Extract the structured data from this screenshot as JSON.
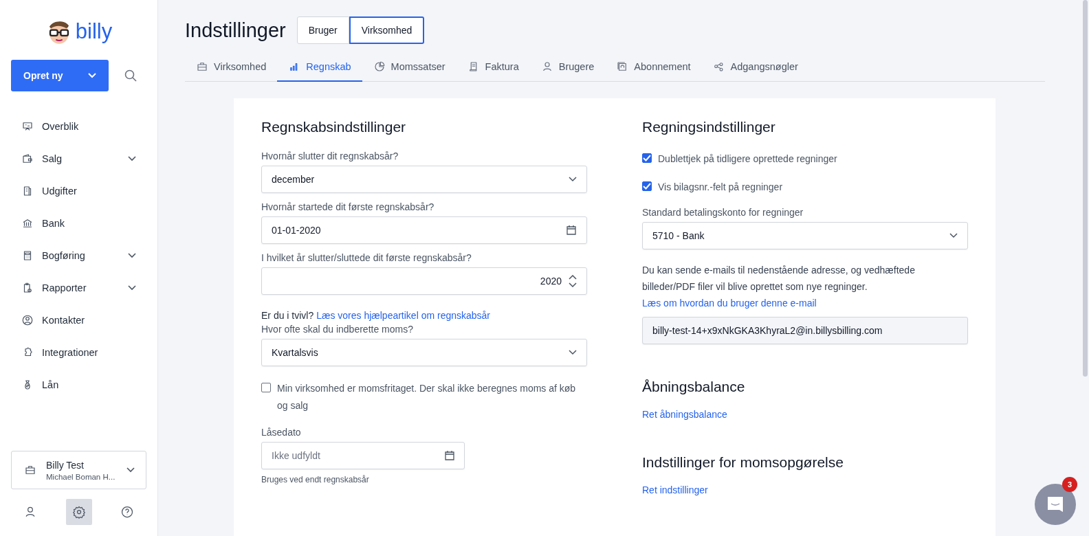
{
  "logo": {
    "text": "billy"
  },
  "create_button": {
    "label": "Opret ny"
  },
  "sidebar": {
    "items": [
      {
        "label": "Overblik",
        "expandable": false,
        "selected": false
      },
      {
        "label": "Salg",
        "expandable": true,
        "selected": false
      },
      {
        "label": "Udgifter",
        "expandable": false,
        "selected": false
      },
      {
        "label": "Bank",
        "expandable": false,
        "selected": false
      },
      {
        "label": "Bogføring",
        "expandable": true,
        "selected": false
      },
      {
        "label": "Rapporter",
        "expandable": true,
        "selected": false
      },
      {
        "label": "Kontakter",
        "expandable": false,
        "selected": false
      },
      {
        "label": "Integrationer",
        "expandable": false,
        "selected": false
      },
      {
        "label": "Lån",
        "expandable": false,
        "selected": false
      }
    ]
  },
  "account": {
    "name": "Billy Test",
    "subtitle": "Michael Boman H..."
  },
  "footer_buttons": [
    {
      "kind": "user",
      "selected": false
    },
    {
      "kind": "settings",
      "selected": true
    },
    {
      "kind": "help",
      "selected": false
    }
  ],
  "page_title": "Indstillinger",
  "scope_toggle": [
    {
      "label": "Bruger",
      "selected": false
    },
    {
      "label": "Virksomhed",
      "selected": true
    }
  ],
  "tabs": [
    {
      "label": "Virksomhed",
      "selected": false
    },
    {
      "label": "Regnskab",
      "selected": true
    },
    {
      "label": "Momssatser",
      "selected": false
    },
    {
      "label": "Faktura",
      "selected": false
    },
    {
      "label": "Brugere",
      "selected": false
    },
    {
      "label": "Abonnement",
      "selected": false
    },
    {
      "label": "Adgangsnøgler",
      "selected": false
    }
  ],
  "left": {
    "title": "Regnskabsindstillinger",
    "items": [
      {
        "kind": "select",
        "label": "Hvornår slutter dit regnskabsår?",
        "value": "december"
      },
      {
        "kind": "date",
        "label": "Hvornår startede dit første regnskabsår?",
        "value": "01-01-2020"
      },
      {
        "kind": "number",
        "label": "I hvilket år slutter/sluttede dit første regnskabsår?",
        "value": "2020"
      },
      {
        "kind": "help",
        "text": "Er du i tvivl?",
        "link": "Læs vores hjælpeartikel om regnskabsår"
      },
      {
        "kind": "select",
        "label": "Hvor ofte skal du indberette moms?",
        "value": "Kvartalsvis"
      },
      {
        "kind": "checkbox",
        "label": "Min virksomhed er momsfritaget. Der skal ikke beregnes moms af køb og salg",
        "checked": false
      },
      {
        "kind": "lockdate",
        "label": "Låsedato",
        "placeholder": "Ikke udfyldt",
        "hint": "Bruges ved endt regnskabsår"
      }
    ]
  },
  "right": {
    "title": "Regningsindstillinger",
    "checkboxes": [
      {
        "label": "Dublettjek på tidligere oprettede regninger",
        "checked": true
      },
      {
        "label": "Vis bilagsnr.-felt på regninger",
        "checked": true
      }
    ],
    "account_select": {
      "label": "Standard betalingskonto for regninger",
      "value": "5710 - Bank"
    },
    "note": {
      "text": "Du kan sende e-mails til nedenstående adresse, og vedhæftede billeder/PDF filer vil blive oprettet som nye regninger.",
      "link": "Læs om hvordan du bruger denne e-mail"
    },
    "email": "billy-test-14+x9xNkGKA3KhyraL2@in.billysbilling.com",
    "sections": [
      {
        "title": "Åbningsbalance",
        "link": "Ret åbningsbalance"
      },
      {
        "title": "Indstillinger for momsopgørelse",
        "link": "Ret indstillinger"
      }
    ]
  },
  "chat": {
    "badge": "3"
  }
}
